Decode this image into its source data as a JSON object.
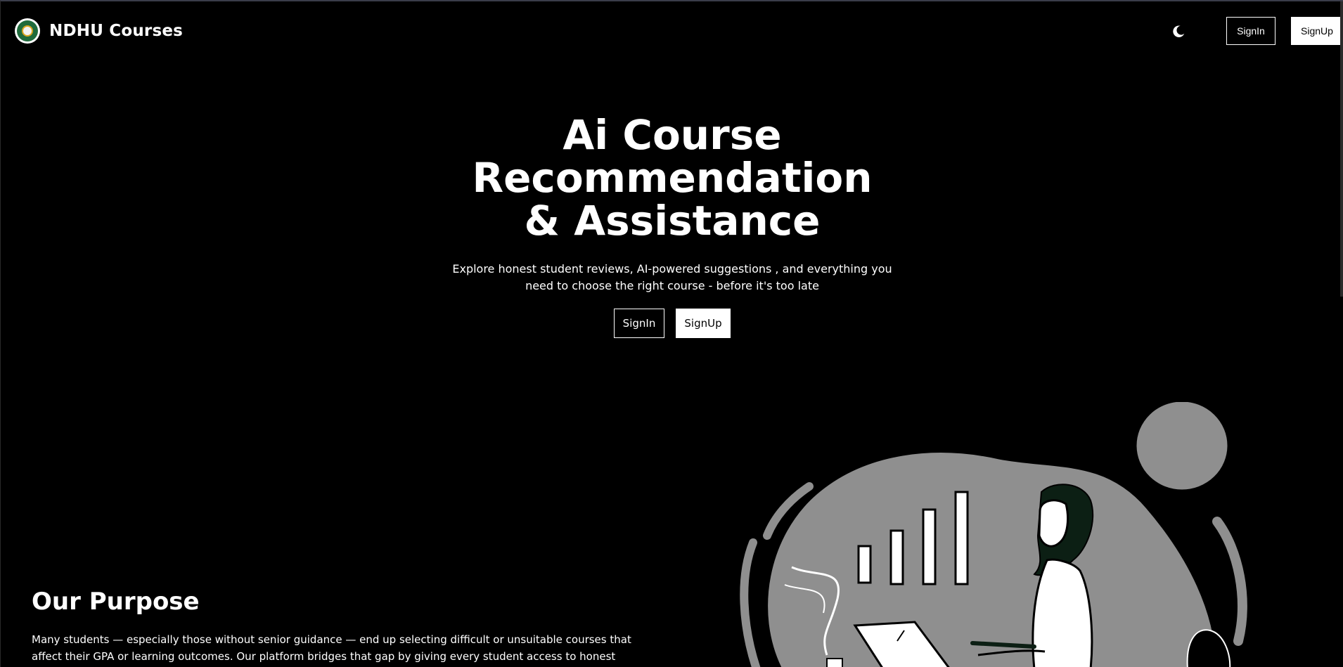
{
  "navbar": {
    "brand_name": "NDHU Courses",
    "logo_icon": "ndhu-emblem-icon",
    "theme_toggle_icon": "moon-icon",
    "signin_label": "SignIn",
    "signup_label": "SignUp"
  },
  "hero": {
    "title_line1": "Ai Course Recommendation",
    "title_line2": "& Assistance",
    "subtitle": "Explore honest student reviews, AI-powered suggestions , and everything you need to choose the right course - before it's too late",
    "signin_label": "SignIn",
    "signup_label": "SignUp"
  },
  "purpose": {
    "title": "Our Purpose",
    "text": "Many students — especially those without senior guidance — end up selecting difficult or unsuitable courses that affect their GPA or learning outcomes. Our platform bridges that gap by giving every student access to honest feedback and relevant data before enrolling."
  },
  "colors": {
    "background": "#000000",
    "text": "#ffffff",
    "illustration_fill": "#8f8f8f",
    "illustration_stroke": "#000000"
  }
}
